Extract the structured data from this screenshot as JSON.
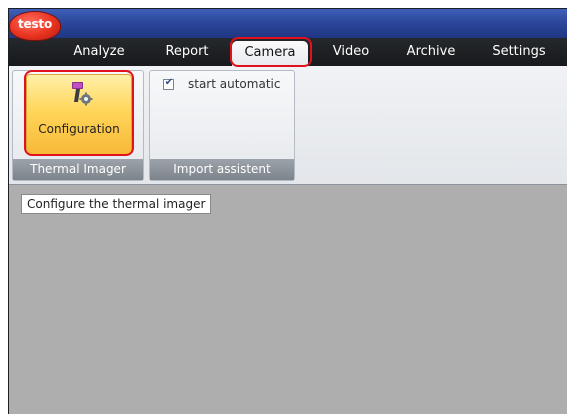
{
  "app": {
    "logo_text": "testo"
  },
  "tabs": [
    {
      "label": "Analyze"
    },
    {
      "label": "Report"
    },
    {
      "label": "Camera",
      "active": true
    },
    {
      "label": "Video"
    },
    {
      "label": "Archive"
    },
    {
      "label": "Settings"
    }
  ],
  "ribbon": {
    "thermal_imager_group": {
      "label": "Thermal Imager",
      "configuration_button": {
        "label": "Configuration",
        "icon": "thermal-camera-gear-icon"
      }
    },
    "import_assistant_group": {
      "label": "Import assistent",
      "start_automatic": {
        "label": "start automatic",
        "checked": true
      }
    }
  },
  "tooltip": {
    "text": "Configure the thermal imager"
  },
  "colors": {
    "highlight": "#e2121c",
    "titlebar": "#2c479c",
    "tabbar": "#17191c",
    "content_bg": "#aeaeae",
    "button_active": "#ffd65a"
  }
}
